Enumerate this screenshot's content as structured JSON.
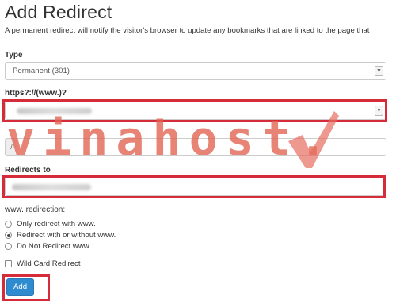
{
  "header": {
    "title": "Add Redirect",
    "description": "A permanent redirect will notify the visitor's browser to update any bookmarks that are linked to the page that"
  },
  "type_field": {
    "label": "Type",
    "selected": "Permanent (301)"
  },
  "domain_field": {
    "label": "https?://(www.)?"
  },
  "path_field": {
    "prefix": "/"
  },
  "redirects_to": {
    "label": "Redirects to"
  },
  "www_redirection": {
    "label": "www. redirection:",
    "options": [
      {
        "label": "Only redirect with www.",
        "selected": false
      },
      {
        "label": "Redirect with or without www.",
        "selected": true
      },
      {
        "label": "Do Not Redirect www.",
        "selected": false
      }
    ]
  },
  "wildcard": {
    "label": "Wild Card Redirect",
    "checked": false
  },
  "add_button": {
    "label": "Add"
  },
  "watermark": {
    "text": "vinahost."
  },
  "colors": {
    "highlight": "#d62b38",
    "button": "#2f8bd0",
    "watermark": "#e0624e"
  },
  "icons": {
    "select_arrow": "chevron-down-icon"
  }
}
